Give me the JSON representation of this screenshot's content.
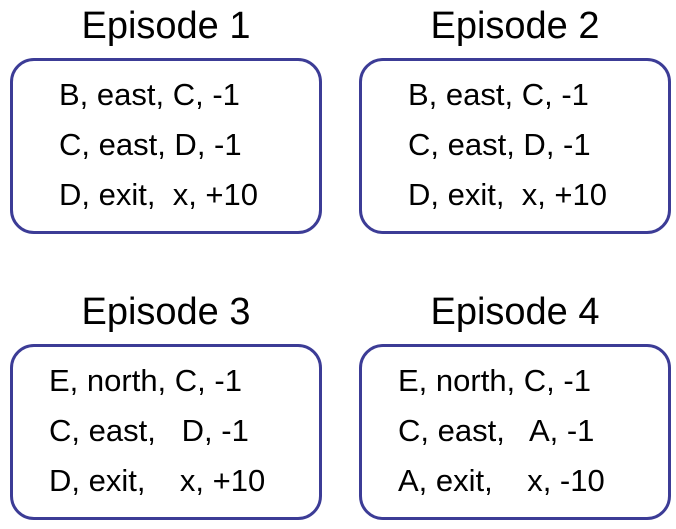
{
  "episodes": [
    {
      "title": "Episode 1",
      "lines": [
        "B, east, C, -1",
        "C, east, D, -1",
        "D, exit,  x, +10"
      ]
    },
    {
      "title": "Episode 2",
      "lines": [
        "B, east, C, -1",
        "C, east, D, -1",
        "D, exit,  x, +10"
      ]
    },
    {
      "title": "Episode 3",
      "lines": [
        "E, north, C, -1",
        "C, east,   D, -1",
        "D, exit,    x, +10"
      ]
    },
    {
      "title": "Episode 4",
      "lines": [
        "E, north, C, -1",
        "C, east,   A, -1",
        "A, exit,    x, -10"
      ]
    }
  ],
  "colors": {
    "box_border": "#3c3c96",
    "text": "#000000",
    "background": "#ffffff"
  }
}
